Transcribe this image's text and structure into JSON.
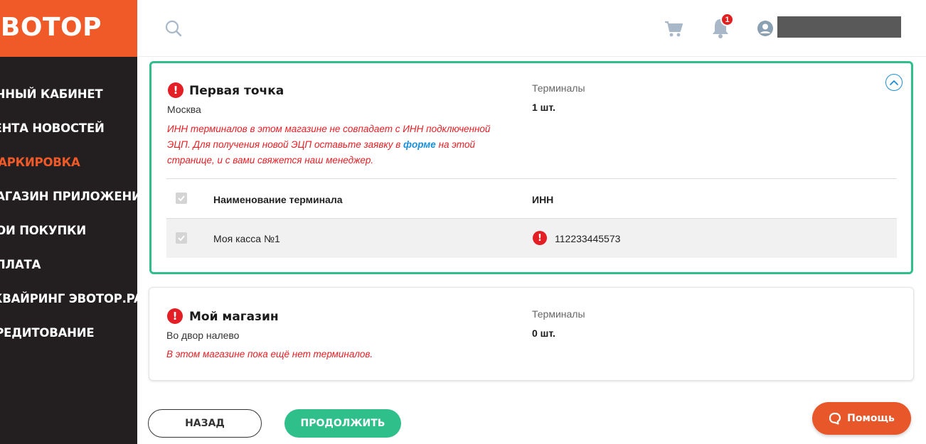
{
  "brand": {
    "logo": "ЭВОТОР",
    "accent": "#f05a28",
    "success": "#2ebf8a",
    "error": "#e31e24",
    "link": "#1a8fd9"
  },
  "sidebar": {
    "items": [
      {
        "label": "ЛИЧНЫЙ КАБИНЕТ"
      },
      {
        "label": "ЛЕНТА НОВОСТЕЙ"
      },
      {
        "label": "МАРКИРОВКА",
        "active": true
      },
      {
        "label": "МАГАЗИН ПРИЛОЖЕНИЙ"
      },
      {
        "label": "МОИ ПОКУПКИ"
      },
      {
        "label": "ОПЛАТА"
      },
      {
        "label": "ЭКВАЙРИНГ ЭВОТОР.PAY"
      },
      {
        "label": "КРЕДИТОВАНИЕ"
      }
    ]
  },
  "header": {
    "icons": [
      "search-icon",
      "cart-icon",
      "bell-icon",
      "user-icon"
    ],
    "notifications_count": "1"
  },
  "stores": [
    {
      "name": "Первая точка",
      "city": "Москва",
      "error_part1": "ИНН терминалов в этом магазине не совпадает с ИНН подключенной ЭЦП. Для получения новой ЭЦП оставьте заявку в ",
      "error_link": "форме",
      "error_part2": " на этой странице, и с вами свяжется наш менеджер.",
      "terminals_label": "Терминалы",
      "terminals_count": "1 шт.",
      "table": {
        "col_name": "Наименование терминала",
        "col_inn": "ИНН",
        "rows": [
          {
            "name": "Моя касса №1",
            "inn": "112233445573"
          }
        ]
      }
    },
    {
      "name": "Мой магазин",
      "city": "Во двор налево",
      "error": "В этом магазине пока ещё нет терминалов.",
      "terminals_label": "Терминалы",
      "terminals_count": "0 шт."
    }
  ],
  "buttons": {
    "back": "НАЗАД",
    "next": "ПРОДОЛЖИТЬ",
    "help": "Помощь"
  }
}
